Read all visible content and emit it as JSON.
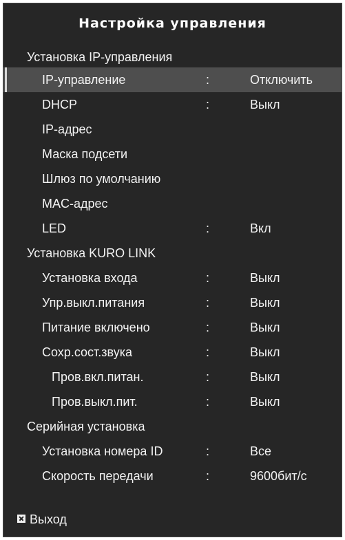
{
  "title": "Настройка управления",
  "ip_section": {
    "header": "Установка IP-управления",
    "ip_control": {
      "label": "IP-управление",
      "value": "Отключить"
    },
    "dhcp": {
      "label": "DHCP",
      "value": "Выкл"
    },
    "ip_address": {
      "label": "IP-адрес"
    },
    "subnet_mask": {
      "label": "Маска подсети"
    },
    "gateway": {
      "label": "Шлюз по умолчанию"
    },
    "mac_address": {
      "label": "MAC-адрес"
    },
    "led": {
      "label": "LED",
      "value": "Вкл"
    }
  },
  "kuro_section": {
    "header": "Установка KURO LINK",
    "input_setting": {
      "label": "Установка входа",
      "value": "Выкл"
    },
    "power_off_control": {
      "label": "Упр.выкл.питания",
      "value": "Выкл"
    },
    "power_on": {
      "label": "Питание включено",
      "value": "Выкл"
    },
    "save_audio_state": {
      "label": "Сохр.сост.звука",
      "value": "Выкл"
    },
    "check_power_on": {
      "label": "Пров.вкл.питан.",
      "value": "Выкл"
    },
    "check_power_off": {
      "label": "Пров.выкл.пит.",
      "value": "Выкл"
    }
  },
  "serial_section": {
    "header": "Серийная установка",
    "id_number": {
      "label": "Установка номера ID",
      "value": "Все"
    },
    "baud_rate": {
      "label": "Скорость передачи",
      "value": "9600бит/с"
    }
  },
  "separator": ":",
  "exit": {
    "label": "Выход",
    "icon": "close-icon"
  }
}
